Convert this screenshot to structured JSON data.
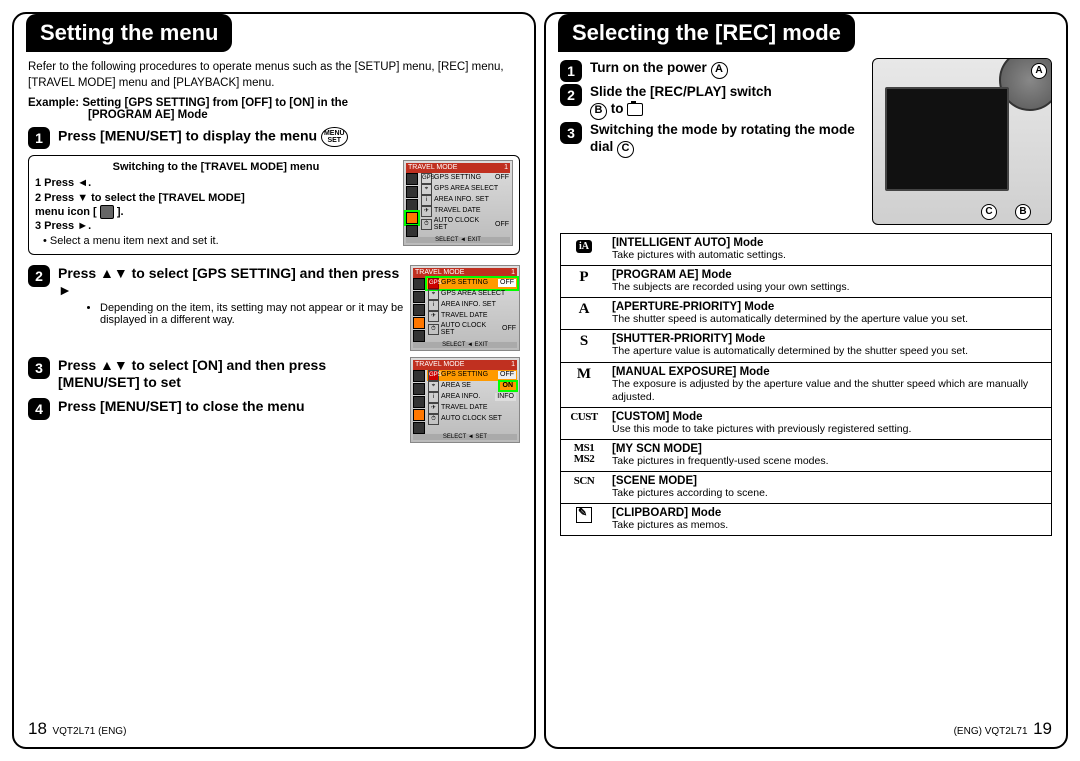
{
  "left": {
    "title": "Setting the menu",
    "intro": "Refer to the following procedures to operate menus such as the [SETUP] menu, [REC] menu, [TRAVEL MODE] menu and [PLAYBACK] menu.",
    "example_line1": "Example: Setting [GPS SETTING] from [OFF] to [ON] in the",
    "example_line2": "[PROGRAM AE] Mode",
    "step1": "Press [MENU/SET] to display the menu",
    "menu_badge_top": "MENU",
    "menu_badge_bot": "SET",
    "switch_hdr": "Switching to the [TRAVEL MODE] menu",
    "sub1": "1 Press ◄.",
    "sub2a": "2 Press ▼ to select the [TRAVEL MODE]",
    "sub2b": "   menu icon [",
    "sub2c": "].",
    "sub3": "3 Press ►.",
    "sub_bullet": "• Select a menu item next and set it.",
    "step2": "Press ▲▼ to select [GPS SETTING] and then press ►",
    "step2_note": "Depending on the item, its setting may not appear or it may be displayed in a different way.",
    "step3": "Press ▲▼ to select [ON] and then press [MENU/SET] to set",
    "step4": "Press [MENU/SET] to close the menu",
    "page_num": "18",
    "page_code": "VQT2L71 (ENG)",
    "screen": {
      "title": "TRAVEL MODE",
      "r1": "GPS SETTING",
      "r1v_off": "OFF",
      "r1v_on": "ON",
      "r2": "GPS AREA SELECT",
      "r3": "AREA INFO. SET",
      "r4": "TRAVEL DATE",
      "r5": "AUTO CLOCK SET",
      "r5v": "OFF",
      "foot": "SELECT ◄  EXIT",
      "foot2": "SELECT ◄  SET"
    }
  },
  "right": {
    "title": "Selecting the [REC] mode",
    "s1": "Turn on the power",
    "s2": "Slide the [REC/PLAY] switch",
    "s2b": "to",
    "s3": "Switching the mode by rotating the mode dial",
    "labels": {
      "A": "A",
      "B": "B",
      "C": "C"
    },
    "modes": [
      {
        "icon": "iA",
        "title": "[INTELLIGENT AUTO] Mode",
        "desc": "Take pictures with automatic settings."
      },
      {
        "icon": "P",
        "title": "[PROGRAM AE] Mode",
        "desc": "The subjects are recorded using your own settings."
      },
      {
        "icon": "A",
        "title": "[APERTURE-PRIORITY] Mode",
        "desc": "The shutter speed is automatically determined by the aperture value you set."
      },
      {
        "icon": "S",
        "title": "[SHUTTER-PRIORITY] Mode",
        "desc": "The aperture value is automatically determined by the shutter speed you set."
      },
      {
        "icon": "M",
        "title": "[MANUAL EXPOSURE] Mode",
        "desc": "The exposure is adjusted by the aperture value and the shutter speed which are manually adjusted."
      },
      {
        "icon": "CUST",
        "title": "[CUSTOM] Mode",
        "desc": "Use this mode to take pictures with previously registered setting."
      },
      {
        "icon": "MS1MS2",
        "title": "[MY SCN MODE]",
        "desc": "Take pictures in frequently-used scene modes."
      },
      {
        "icon": "SCN",
        "title": "[SCENE MODE]",
        "desc": "Take pictures according to scene."
      },
      {
        "icon": "CLIP",
        "title": "[CLIPBOARD] Mode",
        "desc": "Take pictures as memos."
      }
    ],
    "page_num": "19",
    "page_code": "(ENG) VQT2L71"
  }
}
